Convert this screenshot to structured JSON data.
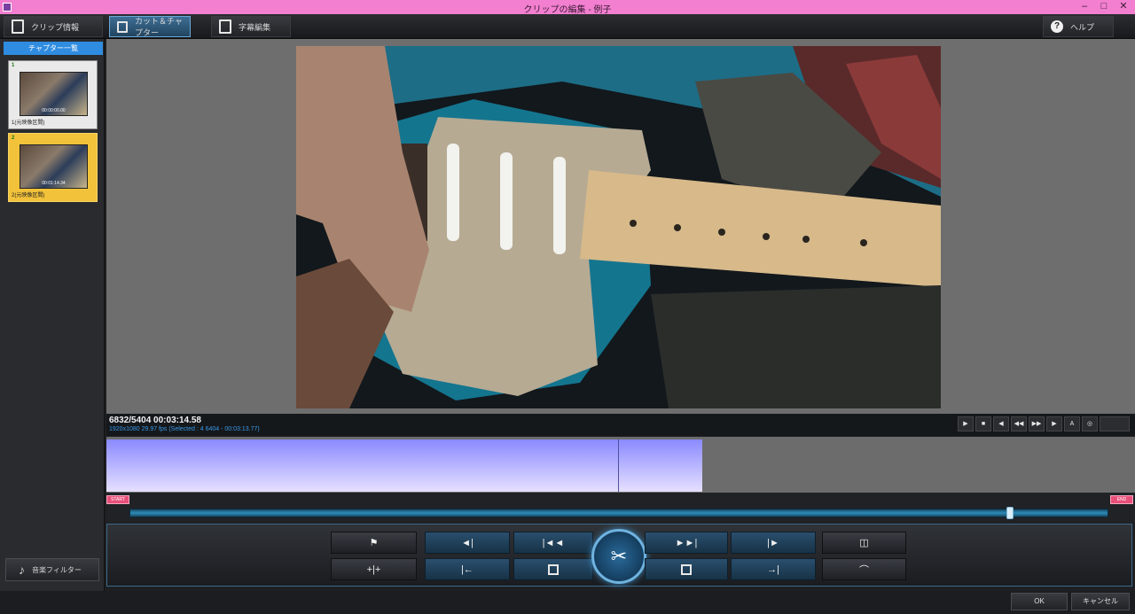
{
  "window": {
    "title": "クリップの編集 - 例子",
    "controls": [
      "–",
      "□",
      "✕"
    ]
  },
  "toolbar": {
    "clip_info_label": "クリップ情報",
    "cut_label": "カット＆チャプター",
    "subtitle_label": "字幕編集",
    "help_label": "ヘルプ"
  },
  "sidebar": {
    "header": "チャプター一覧",
    "clips": [
      {
        "num": "1",
        "timecode": "00:00:00.00",
        "label": "1(元映像区間)"
      },
      {
        "num": "2",
        "timecode": "00:01:14.34",
        "label": "2(元映像区間)"
      }
    ],
    "music_label": "音楽フィルター"
  },
  "info": {
    "frame": "6832/5404  00:03:14.58",
    "meta": "1920x1080 29.97 fps  (Selected : 4   6404 - 00:03:13.77)"
  },
  "transport": [
    "▶",
    "■",
    "◀",
    "◀◀",
    "▶▶",
    "▶",
    "A",
    "◎"
  ],
  "markers": {
    "start": "START",
    "end": "END"
  },
  "playhead": 0.9,
  "panel_icons": {
    "flag": "⚑",
    "split": "+|+",
    "prev_mark": "◄|",
    "prev_frame": "|◄◄",
    "next_frame": "►►|",
    "next_mark": "|►",
    "go_in": "|←",
    "go_out": "→|",
    "cut": "✂",
    "gap": "◫",
    "curve": "⌒"
  },
  "buttons": {
    "ok": "OK",
    "cancel": "キャンセル"
  }
}
